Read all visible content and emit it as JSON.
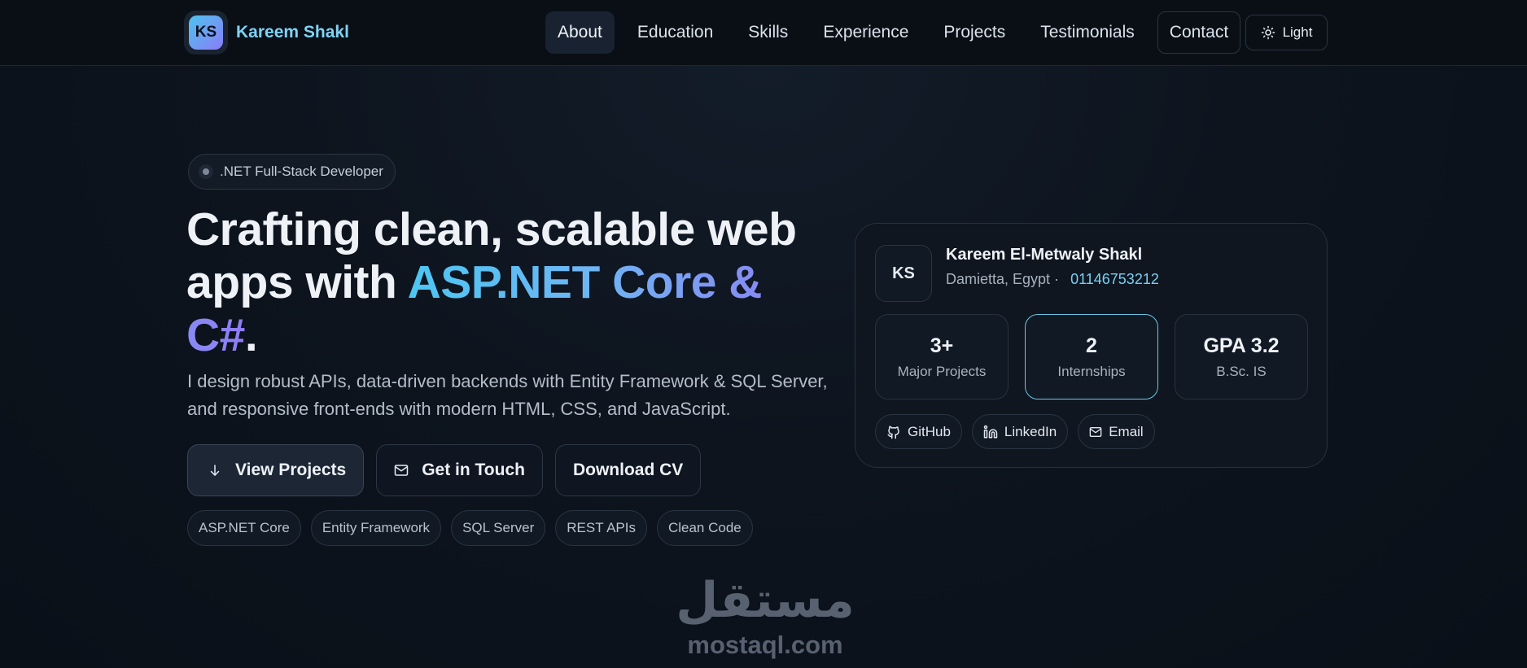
{
  "nav": {
    "brand_initials": "KS",
    "brand_name": "Kareem Shakl",
    "links": [
      {
        "label": "About"
      },
      {
        "label": "Education"
      },
      {
        "label": "Skills"
      },
      {
        "label": "Experience"
      },
      {
        "label": "Projects"
      },
      {
        "label": "Testimonials"
      },
      {
        "label": "Contact"
      }
    ],
    "active_link": "About",
    "theme_toggle_label": "Light",
    "theme_icon": "sun-icon"
  },
  "hero": {
    "badge": ".NET Full-Stack Developer",
    "headline_part1": "Crafting clean, scalable web apps with ",
    "headline_highlight": "ASP.NET Core & C#",
    "headline_end": ".",
    "subtext": "I design robust APIs, data-driven backends with Entity Framework & SQL Server, and responsive front-ends with modern HTML, CSS, and JavaScript.",
    "buttons": {
      "view_projects": "View Projects",
      "get_in_touch": "Get in Touch",
      "download_cv": "Download CV"
    },
    "tags": [
      "ASP.NET Core",
      "Entity Framework",
      "SQL Server",
      "REST APIs",
      "Clean Code"
    ]
  },
  "profile_card": {
    "initials": "KS",
    "name": "Kareem El-Metwaly Shakl",
    "location": "Damietta, Egypt ·",
    "phone": "01146753212",
    "stats": [
      {
        "value": "3+",
        "label": "Major Projects"
      },
      {
        "value": "2",
        "label": "Internships"
      },
      {
        "value": "GPA 3.2",
        "label": "B.Sc. IS"
      }
    ],
    "socials": [
      {
        "label": "GitHub",
        "icon": "github-icon"
      },
      {
        "label": "LinkedIn",
        "icon": "linkedin-icon"
      },
      {
        "label": "Email",
        "icon": "mail-icon"
      }
    ]
  },
  "watermark": {
    "arabic": "مستقل",
    "latin": "mostaql.com"
  },
  "colors": {
    "background": "#0b111a",
    "accent_cyan": "#4cc6f2",
    "accent_violet": "#8f7cf4",
    "phone_link": "#7ad0f4"
  }
}
